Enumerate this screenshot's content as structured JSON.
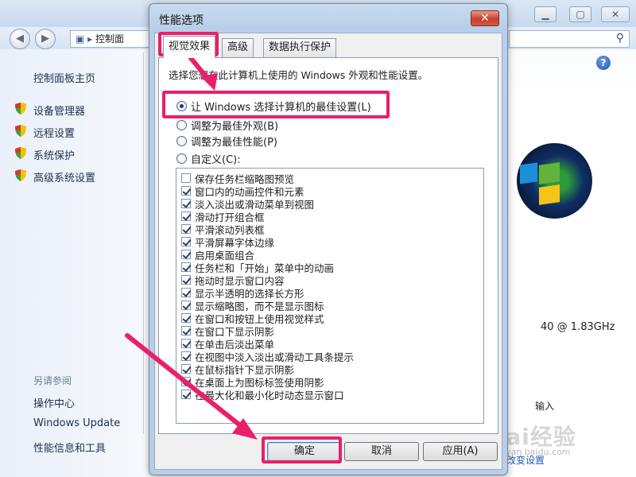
{
  "background_window": {
    "address_text": "控制面",
    "sidebar": {
      "home": "控制面板主页",
      "items": [
        "设备管理器",
        "远程设置",
        "系统保护",
        "高级系统设置"
      ],
      "see_also_title": "另请参阅",
      "see_also": [
        "操作中心",
        "Windows Update",
        "性能信息和工具"
      ]
    },
    "cpu_text": "40 @ 1.83GHz",
    "input_text": "输入",
    "change_settings_text": "改变设置"
  },
  "dialog": {
    "title": "性能选项",
    "close_label": "✕",
    "tabs": [
      "视觉效果",
      "高级",
      "数据执行保护"
    ],
    "intro": "选择您想在此计算机上使用的 Windows 外观和性能设置。",
    "radios": [
      {
        "label": "让 Windows 选择计算机的最佳设置(L)",
        "selected": true
      },
      {
        "label": "调整为最佳外观(B)",
        "selected": false
      },
      {
        "label": "调整为最佳性能(P)",
        "selected": false
      },
      {
        "label": "自定义(C):",
        "selected": false
      }
    ],
    "effects": [
      {
        "label": "保存任务栏缩略图预览",
        "checked": false
      },
      {
        "label": "窗口内的动画控件和元素",
        "checked": true
      },
      {
        "label": "淡入淡出或滑动菜单到视图",
        "checked": true
      },
      {
        "label": "滑动打开组合框",
        "checked": true
      },
      {
        "label": "平滑滚动列表框",
        "checked": true
      },
      {
        "label": "平滑屏幕字体边缘",
        "checked": true
      },
      {
        "label": "启用桌面组合",
        "checked": true
      },
      {
        "label": "任务栏和「开始」菜单中的动画",
        "checked": true
      },
      {
        "label": "拖动时显示窗口内容",
        "checked": true
      },
      {
        "label": "显示半透明的选择长方形",
        "checked": true
      },
      {
        "label": "显示缩略图，而不是显示图标",
        "checked": true
      },
      {
        "label": "在窗口和按钮上使用视觉样式",
        "checked": true
      },
      {
        "label": "在窗口下显示阴影",
        "checked": true
      },
      {
        "label": "在单击后淡出菜单",
        "checked": true
      },
      {
        "label": "在视图中淡入淡出或滑动工具条提示",
        "checked": true
      },
      {
        "label": "在鼠标指针下显示阴影",
        "checked": true
      },
      {
        "label": "在桌面上为图标标签使用阴影",
        "checked": true
      },
      {
        "label": "在最大化和最小化时动态显示窗口",
        "checked": true
      }
    ],
    "buttons": {
      "ok": "确定",
      "cancel": "取消",
      "apply": "应用(A)"
    }
  },
  "watermark": {
    "main": "Bai经验",
    "sub": "jingyan.baidu.com"
  },
  "colors": {
    "highlight": "#ea1f6a",
    "dialog_frame": "#b9cfe9"
  }
}
